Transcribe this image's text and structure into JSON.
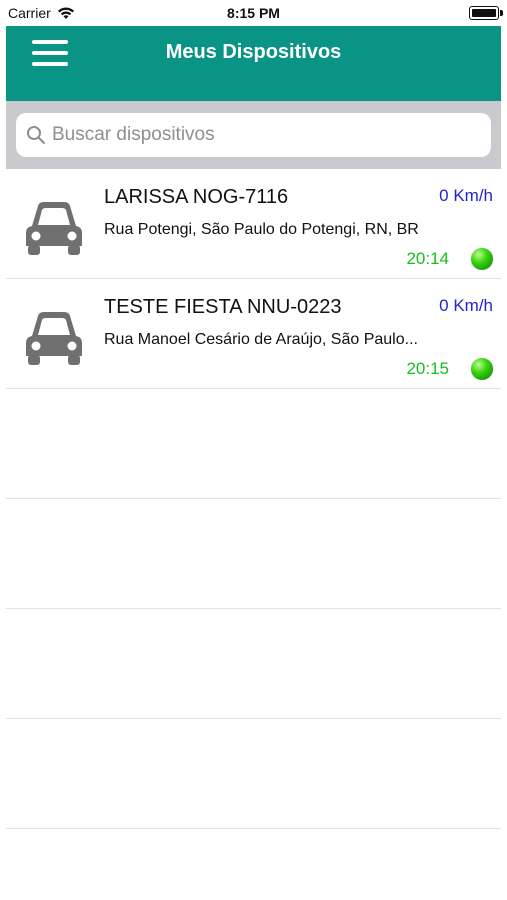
{
  "status_bar": {
    "carrier": "Carrier",
    "time": "8:15 PM"
  },
  "nav": {
    "title": "Meus Dispositivos",
    "menu_icon": "hamburger-menu-icon"
  },
  "search": {
    "placeholder": "Buscar dispositivos",
    "value": ""
  },
  "colors": {
    "header": "#0a9486",
    "speed": "#2424c8",
    "time": "#19c019",
    "status_online": "#3ad10d"
  },
  "devices": [
    {
      "name": "LARISSA NOG-7116",
      "speed": "0 Km/h",
      "address": "Rua Potengi, São Paulo do Potengi, RN, BR",
      "time": "20:14",
      "status": "online",
      "icon": "car-icon"
    },
    {
      "name": "TESTE FIESTA NNU-0223",
      "speed": "0 Km/h",
      "address": "Rua Manoel Cesário de Araújo, São Paulo...",
      "time": "20:15",
      "status": "online",
      "icon": "car-icon"
    }
  ]
}
